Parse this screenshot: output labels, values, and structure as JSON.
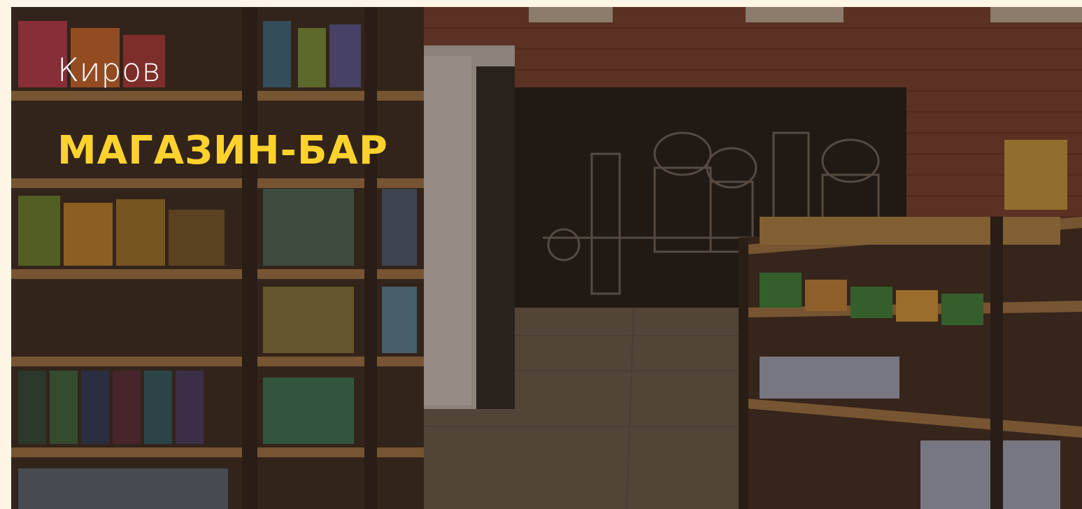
{
  "hero": {
    "city": "Киров",
    "title": "МАГАЗИН-БАР"
  },
  "colors": {
    "page_background": "#fdf5e6",
    "title_accent": "#ffd22e",
    "city_text": "#ffffff"
  }
}
